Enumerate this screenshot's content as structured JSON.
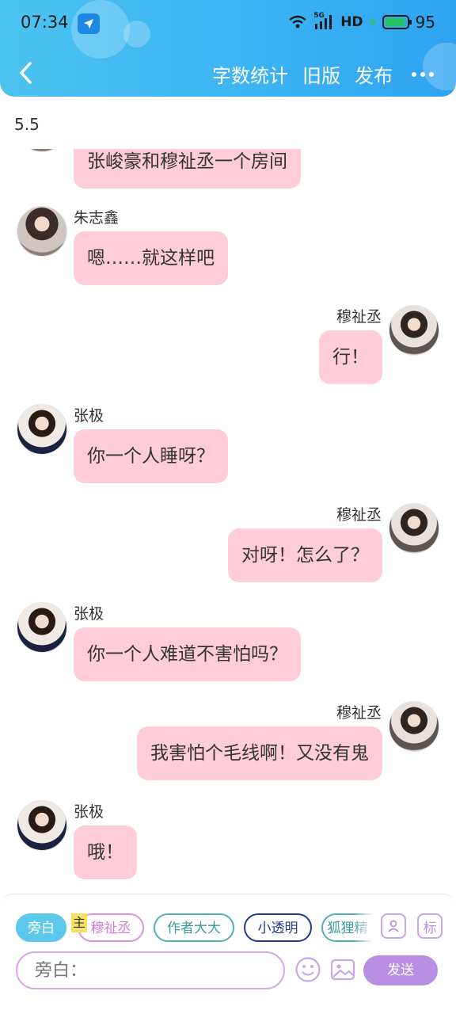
{
  "status_bar": {
    "time": "07:34",
    "network": "5G",
    "hd": "HD",
    "battery": "95",
    "battery_fill": 0.95
  },
  "nav": {
    "word_count": "字数统计",
    "old_version": "旧版",
    "publish": "发布"
  },
  "chapter_title": "5.5",
  "messages": [
    {
      "side": "left",
      "sender": "",
      "text": "张峻豪和穆祉丞一个房间",
      "partial": true
    },
    {
      "side": "left",
      "sender": "朱志鑫",
      "text": "嗯……就这样吧"
    },
    {
      "side": "right",
      "sender": "穆祉丞",
      "text": "行！"
    },
    {
      "side": "left",
      "sender": "张极",
      "text": "你一个人睡呀？"
    },
    {
      "side": "right",
      "sender": "穆祉丞",
      "text": "对呀！怎么了？"
    },
    {
      "side": "left",
      "sender": "张极",
      "text": "你一个人难道不害怕吗？"
    },
    {
      "side": "right",
      "sender": "穆祉丞",
      "text": "我害怕个毛线啊！又没有鬼"
    },
    {
      "side": "left",
      "sender": "张极",
      "text": "哦！"
    }
  ],
  "composer": {
    "roles": [
      "旁白",
      "穆祉丞",
      "作者大大",
      "小透明",
      "狐狸精"
    ],
    "main_tag": "主",
    "mark_label": "标",
    "input_placeholder": "旁白：",
    "send": "发送"
  },
  "colors": {
    "header": "#3bb4f2",
    "bubble": "#ffccd9",
    "send": "#b98fe4"
  }
}
